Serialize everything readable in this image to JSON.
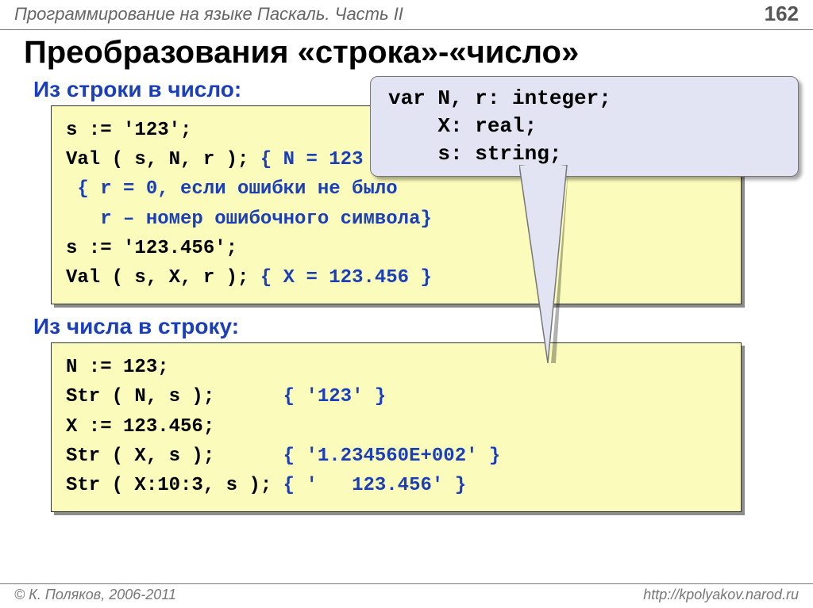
{
  "header": {
    "breadcrumb": "Программирование на языке Паскаль. Часть II",
    "page_number": "162"
  },
  "title": "Преобразования «строка»-«число»",
  "var_box": {
    "line1": "var N, r: integer;",
    "line2": "    X: real;",
    "line3": "    s: string;"
  },
  "section1": {
    "heading": "Из строки в число:",
    "l1_a": "s := '123';",
    "l2_a": "Val ( s, N, r ); ",
    "l2_c": "{ N = 123 }",
    "l3_c": " { r = 0, если ошибки не было",
    "l4_c": "   r – номер ошибочного символа}",
    "l5_a": "s := '123.456';",
    "l6_a": "Val ( s, X, r ); ",
    "l6_c": "{ X = 123.456 }"
  },
  "section2": {
    "heading": "Из числа в строку:",
    "l1_a": "N := 123;",
    "l2_a": "Str ( N, s );      ",
    "l2_c": "{ '123' }",
    "l3_a": "X := 123.456;",
    "l4_a": "Str ( X, s );      ",
    "l4_c": "{ '1.234560E+002' }",
    "l5_a": "Str ( X:10:3, s ); ",
    "l5_c": "{ '   123.456' }"
  },
  "footer": {
    "copyright": "© К. Поляков, 2006-2011",
    "url": "http://kpolyakov.narod.ru"
  }
}
